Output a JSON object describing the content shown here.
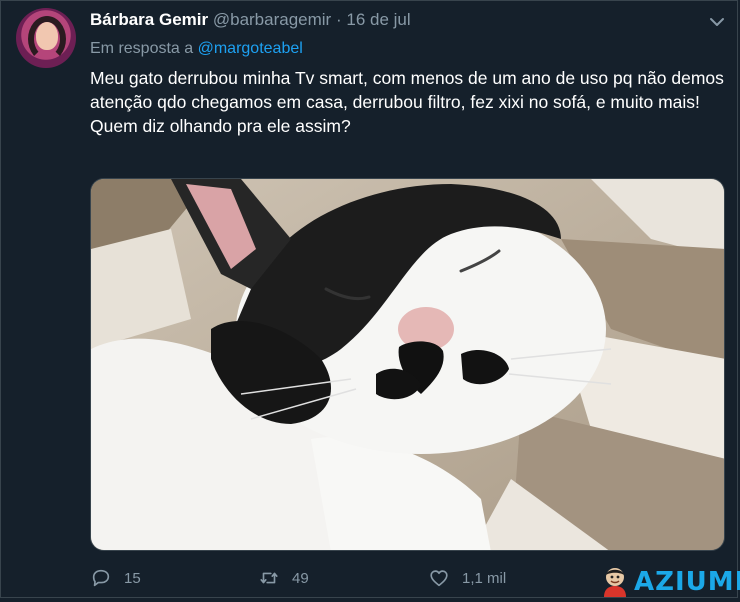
{
  "tweet": {
    "author_name": "Bárbara Gemir",
    "handle": "@barbaragemir",
    "separator": "·",
    "date": "16 de jul",
    "reply_prefix": "Em resposta a",
    "reply_to": "@margoteabel",
    "text_lines": [
      "Meu gato derrubou minha Tv smart, com menos de um ano de uso pq não demos atenção qdo chegamos em casa, derrubou filtro, fez xixi no sofá, e muito mais!",
      "Quem diz olhando pra ele assim?"
    ],
    "actions": {
      "replies": "15",
      "retweets": "49",
      "likes": "1,1 mil"
    }
  },
  "watermark": {
    "brand": "AZIUME"
  },
  "colors": {
    "background": "#15202b",
    "text": "#ffffff",
    "muted": "#8899a6",
    "link": "#1da1f2",
    "watermark": "#1ba8e8"
  },
  "icons": [
    "user-avatar",
    "chevron-down-icon",
    "reply-icon",
    "retweet-icon",
    "like-icon",
    "mascot-icon"
  ]
}
